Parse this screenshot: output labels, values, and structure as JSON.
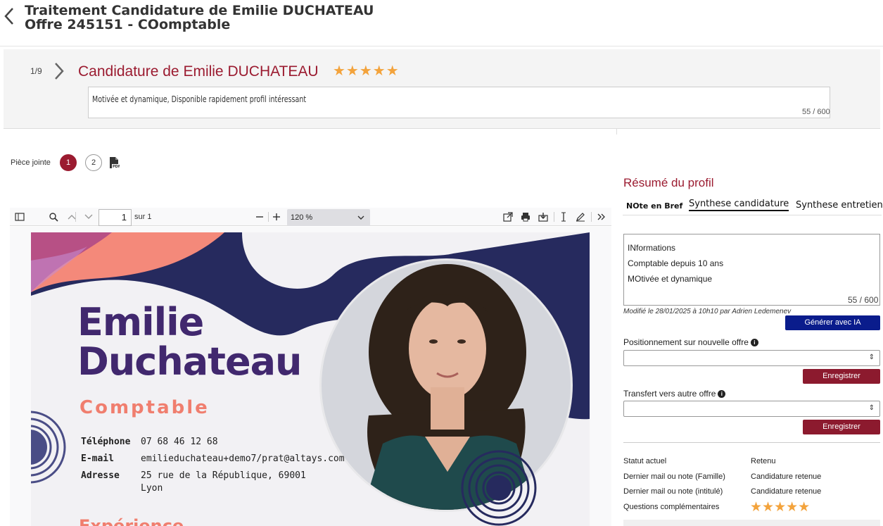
{
  "header": {
    "title_line1": "Traitement Candidature de Emilie DUCHATEAU",
    "title_line2": "Offre 245151 - COomptable"
  },
  "candidate_band": {
    "counter": "1/9",
    "title": "Candidature de Emilie DUCHATEAU",
    "stars": "★★★★★",
    "note_text": "Motivée et dynamique, Disponible rapidement profil intéressant",
    "note_count": "55 / 600"
  },
  "attachments": {
    "label": "Pièce jointe",
    "items": [
      "1",
      "2"
    ]
  },
  "pdf_toolbar": {
    "page_value": "1",
    "page_of": "sur 1",
    "zoom": "120 %",
    "icons": [
      "sidebar-icon",
      "search-icon",
      "arrow-up-icon",
      "arrow-down-icon",
      "zoom-out-icon",
      "zoom-in-icon",
      "open-external-icon",
      "print-icon",
      "download-icon",
      "text-cursor-icon",
      "draw-icon",
      "more-tools-icon"
    ]
  },
  "cv": {
    "first_name": "Emilie",
    "last_name": "Duchateau",
    "role": "Comptable",
    "phone_label": "Téléphone",
    "phone": "07 68 46 12 68",
    "email_label": "E-mail",
    "email": "emilieduchateau+demo7/prat@altays.com",
    "address_label": "Adresse",
    "address_line1": "25 rue de la République, 69001",
    "address_line2": "Lyon",
    "section_heading": "Expérience",
    "colors": {
      "navy": "#262a5e",
      "coral": "#f07e6e",
      "purple": "#41286e"
    }
  },
  "right_panel": {
    "title": "Résumé du profil",
    "tabs": [
      "NOte en Bref",
      "Synthese candidature",
      "Synthese entretien"
    ],
    "active_tab": "Synthese candidature",
    "synthese_lines": [
      "INformations",
      "Comptable depuis 10 ans",
      "MOtivée et dynamique"
    ],
    "synthese_count": "55 / 600",
    "modified": "Modifié le 28/01/2025 à 10h10 par Adrien Ledemenev",
    "generate_button": "Générer avec IA",
    "positioning_label": "Positionnement sur nouvelle offre",
    "transfer_label": "Transfert vers autre offre",
    "save_button": "Enregistrer",
    "status": [
      {
        "key": "Statut actuel",
        "value": "Retenu"
      },
      {
        "key": "Dernier mail ou note (Famille)",
        "value": "Candidature retenue"
      },
      {
        "key": "Dernier mail ou note (intitulé)",
        "value": "Candidature retenue"
      },
      {
        "key": "Questions complémentaires",
        "value": ""
      }
    ],
    "bottom_stars": "★★★★★"
  },
  "colors": {
    "brand": "#9b1b30",
    "save": "#8c1a2e",
    "ia": "#0a1c8c",
    "star": "#f3a33c"
  }
}
